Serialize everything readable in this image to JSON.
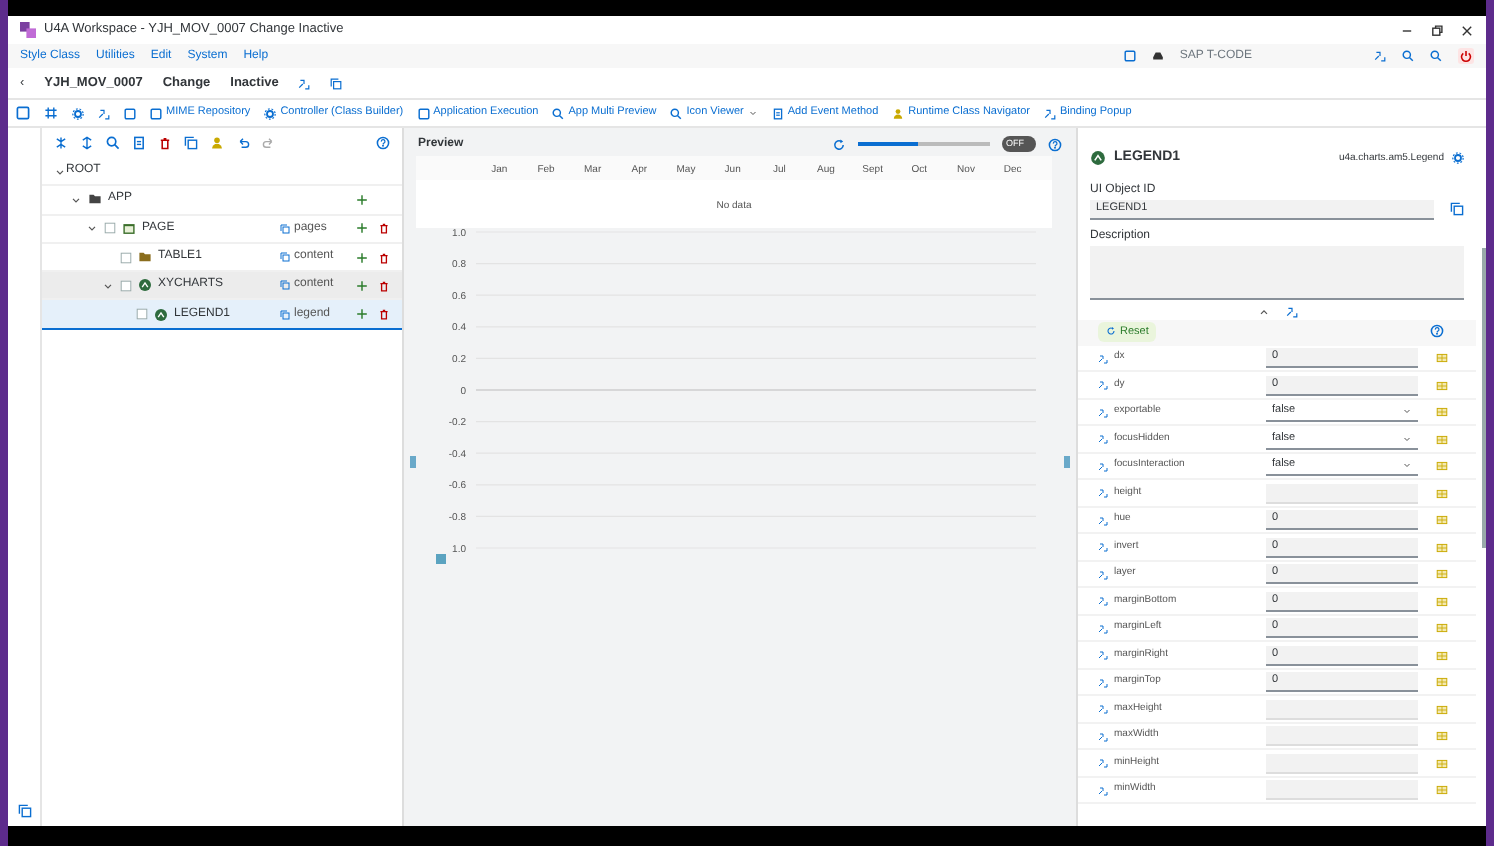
{
  "window": {
    "title": "U4A Workspace - YJH_MOV_0007 Change Inactive"
  },
  "menu": [
    "Style Class",
    "Utilities",
    "Edit",
    "System",
    "Help"
  ],
  "tcode_label": "SAP T-CODE",
  "title_row": {
    "back": "‹",
    "object": "YJH_MOV_0007",
    "mode": "Change",
    "status": "Inactive"
  },
  "toolbar": {
    "buttons": [
      {
        "label": "MIME Repository",
        "dropdown": false
      },
      {
        "label": "Controller (Class Builder)",
        "dropdown": false
      },
      {
        "label": "Application Execution",
        "dropdown": false
      },
      {
        "label": "App Multi Preview",
        "dropdown": false
      },
      {
        "label": "Icon Viewer",
        "dropdown": true
      },
      {
        "label": "Add Event Method",
        "dropdown": false
      },
      {
        "label": "Runtime Class Navigator",
        "dropdown": false
      },
      {
        "label": "Binding Popup",
        "dropdown": false
      }
    ]
  },
  "tree": [
    {
      "name": "ROOT",
      "expanded": true,
      "selected": false,
      "hovered": false,
      "can_add": false,
      "can_delete": false,
      "children": [
        {
          "name": "APP",
          "kind": "app",
          "expanded": true,
          "selected": false,
          "hovered": false,
          "can_add": true,
          "can_delete": false,
          "children": [
            {
              "name": "PAGE",
              "kind": "page",
              "aggregation": "pages",
              "checked": false,
              "expanded": true,
              "selected": false,
              "hovered": false,
              "can_add": true,
              "can_delete": true,
              "children": [
                {
                  "name": "TABLE1",
                  "kind": "folder",
                  "aggregation": "content",
                  "checked": false,
                  "expanded": false,
                  "selected": false,
                  "hovered": false,
                  "can_add": true,
                  "can_delete": true
                },
                {
                  "name": "XYCHARTS",
                  "kind": "chart",
                  "aggregation": "content",
                  "checked": false,
                  "expanded": true,
                  "selected": false,
                  "hovered": true,
                  "can_add": true,
                  "can_delete": true,
                  "children": [
                    {
                      "name": "LEGEND1",
                      "kind": "chart",
                      "aggregation": "legend",
                      "checked": false,
                      "selected": true,
                      "hovered": false,
                      "can_add": true,
                      "can_delete": true
                    }
                  ]
                }
              ]
            }
          ]
        }
      ]
    }
  ],
  "preview": {
    "title": "Preview",
    "slider": {
      "level": 0.45
    },
    "toggle": {
      "label": "OFF",
      "on": false
    },
    "no_data": "No data",
    "chart_data": {
      "type": "line",
      "grid": true,
      "categories": [
        "Jan",
        "Feb",
        "Mar",
        "Apr",
        "May",
        "Jun",
        "Jul",
        "Aug",
        "Sept",
        "Oct",
        "Nov",
        "Dec"
      ],
      "ylim": [
        -1,
        1
      ],
      "yticks": [
        {
          "value": 1,
          "label": "1.0"
        },
        {
          "value": 0.8,
          "label": "0.8"
        },
        {
          "value": 0.6,
          "label": "0.6"
        },
        {
          "value": 0.4,
          "label": "0.4"
        },
        {
          "value": 0.2,
          "label": "0.2"
        },
        {
          "value": 0,
          "label": "0"
        },
        {
          "value": -0.2,
          "label": "-0.2"
        },
        {
          "value": -0.4,
          "label": "-0.4"
        },
        {
          "value": -0.6,
          "label": "-0.6"
        },
        {
          "value": -0.8,
          "label": "-0.8"
        },
        {
          "value": -1,
          "label": "1.0"
        }
      ]
    }
  },
  "inspector": {
    "object_name": "LEGEND1",
    "class_name": "u4a.charts.am5.Legend",
    "id_label": "UI Object ID",
    "id_value": "LEGEND1",
    "description_label": "Description",
    "reset": "Reset",
    "properties": [
      {
        "name": "dx",
        "kind": "input",
        "value": "0"
      },
      {
        "name": "dy",
        "kind": "input",
        "value": "0"
      },
      {
        "name": "exportable",
        "kind": "select",
        "value": "false"
      },
      {
        "name": "focusHidden",
        "kind": "select",
        "value": "false"
      },
      {
        "name": "focusInteraction",
        "kind": "select",
        "value": "false"
      },
      {
        "name": "height",
        "kind": "input"
      },
      {
        "name": "hue",
        "kind": "input",
        "value": "0"
      },
      {
        "name": "invert",
        "kind": "input",
        "value": "0"
      },
      {
        "name": "layer",
        "kind": "input",
        "value": "0"
      },
      {
        "name": "marginBottom",
        "kind": "input",
        "value": "0"
      },
      {
        "name": "marginLeft",
        "kind": "input",
        "value": "0"
      },
      {
        "name": "marginRight",
        "kind": "input",
        "value": "0"
      },
      {
        "name": "marginTop",
        "kind": "input",
        "value": "0"
      },
      {
        "name": "maxHeight",
        "kind": "input"
      },
      {
        "name": "maxWidth",
        "kind": "input"
      },
      {
        "name": "minHeight",
        "kind": "input"
      },
      {
        "name": "minWidth",
        "kind": "input"
      }
    ]
  }
}
